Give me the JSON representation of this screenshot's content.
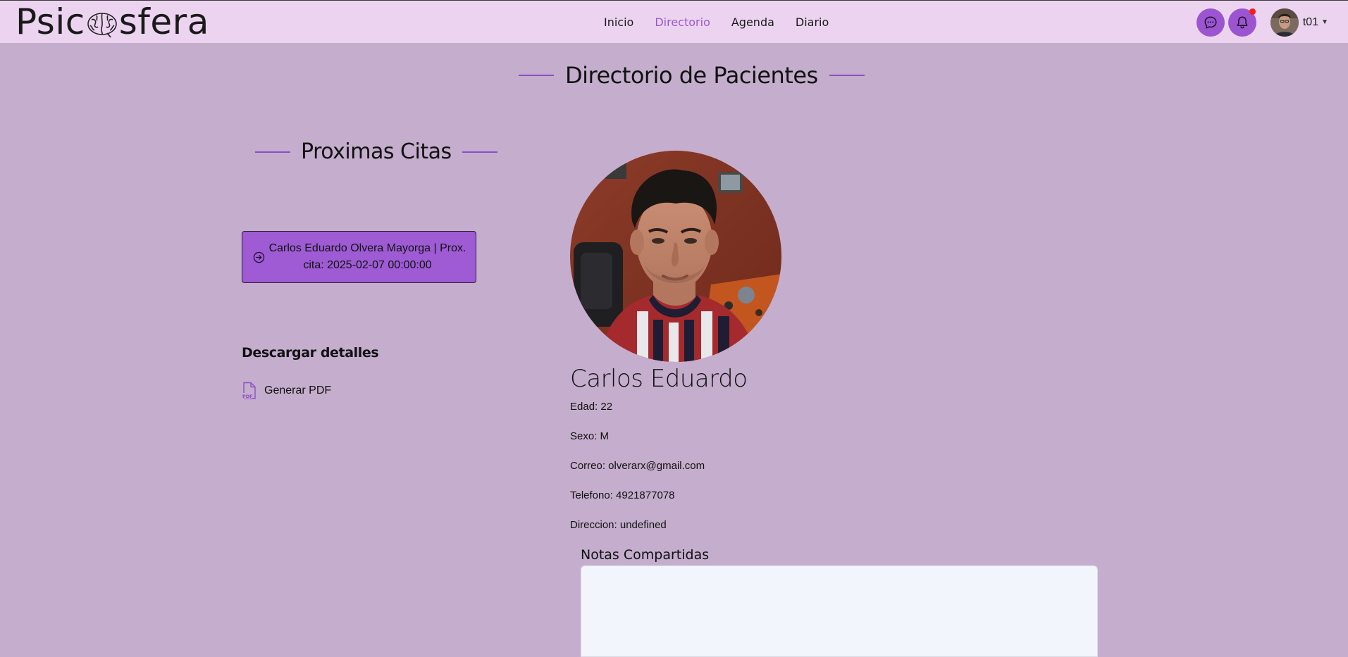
{
  "brand": {
    "name_left": "Psic",
    "name_right": "sfera"
  },
  "nav": {
    "links": [
      {
        "label": "Inicio",
        "active": false
      },
      {
        "label": "Directorio",
        "active": true
      },
      {
        "label": "Agenda",
        "active": false
      },
      {
        "label": "Diario",
        "active": false
      }
    ],
    "username": "t01",
    "notification_dot": true
  },
  "page": {
    "title": "Directorio de Pacientes"
  },
  "appointments": {
    "title": "Proximas Citas",
    "items": [
      {
        "text": "Carlos Eduardo Olvera Mayorga | Prox. cita: 2025-02-07 00:00:00"
      }
    ]
  },
  "download": {
    "heading": "Descargar detalles",
    "pdf_label": "Generar PDF"
  },
  "patient": {
    "name": "Carlos Eduardo",
    "edad": "Edad: 22",
    "sexo": "Sexo: M",
    "correo": "Correo: olverarx@gmail.com",
    "telefono": "Telefono: 4921877078",
    "direccion": "Direccion: undefined"
  },
  "notes": {
    "label": "Notas Compartidas",
    "value": ""
  },
  "colors": {
    "page_bg": "#c5adcd",
    "navbar_bg": "#ecd4f1",
    "accent": "#9b55d1",
    "active_link": "#9a58c9",
    "notification": "#ff1a1a"
  }
}
